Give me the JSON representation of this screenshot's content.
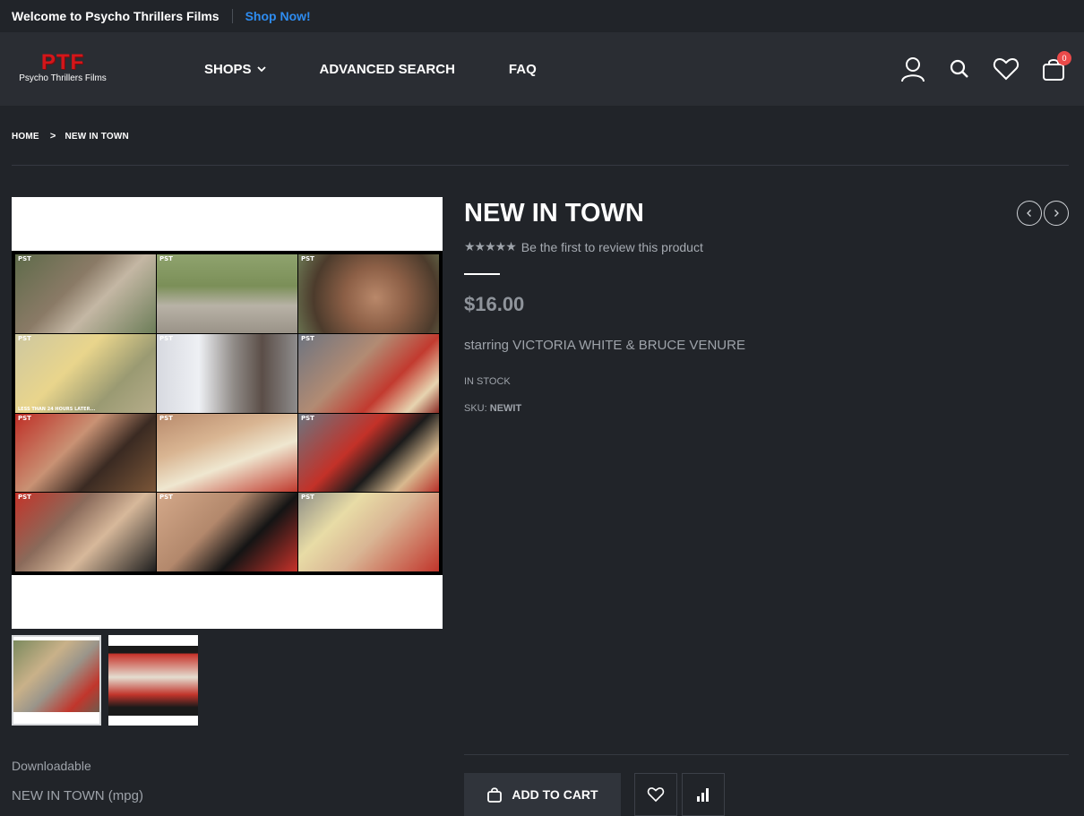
{
  "topbar": {
    "welcome": "Welcome to Psycho Thrillers Films",
    "shop_now": "Shop Now!"
  },
  "header": {
    "logo_mark": "PTF",
    "logo_text": "Psycho Thrillers Films",
    "nav": {
      "shops": "SHOPS",
      "advanced_search": "ADVANCED SEARCH",
      "faq": "FAQ"
    },
    "cart_count": "0"
  },
  "breadcrumb": {
    "home": "HOME",
    "separator": ">",
    "current": "NEW IN TOWN"
  },
  "gallery": {
    "cell_label": "PST",
    "caption": "LESS THAN 24 HOURS LATER..."
  },
  "product": {
    "title": "NEW IN TOWN",
    "stars": "★★★★★",
    "review_link": "Be the first to review this product",
    "price": "$16.00",
    "description": "starring VICTORIA WHITE & BRUCE VENURE",
    "stock": "IN STOCK",
    "sku_label": "SKU:",
    "sku_value": "NEWIT"
  },
  "downloadable": {
    "heading": "Downloadable",
    "item": "NEW IN TOWN (mpg)"
  },
  "actions": {
    "add_to_cart": "ADD TO CART"
  },
  "colors": {
    "background": "#212429",
    "header": "#2a2d33",
    "accent_link": "#2e8cf0",
    "badge": "#e94a4a",
    "logo": "#d4161a"
  }
}
